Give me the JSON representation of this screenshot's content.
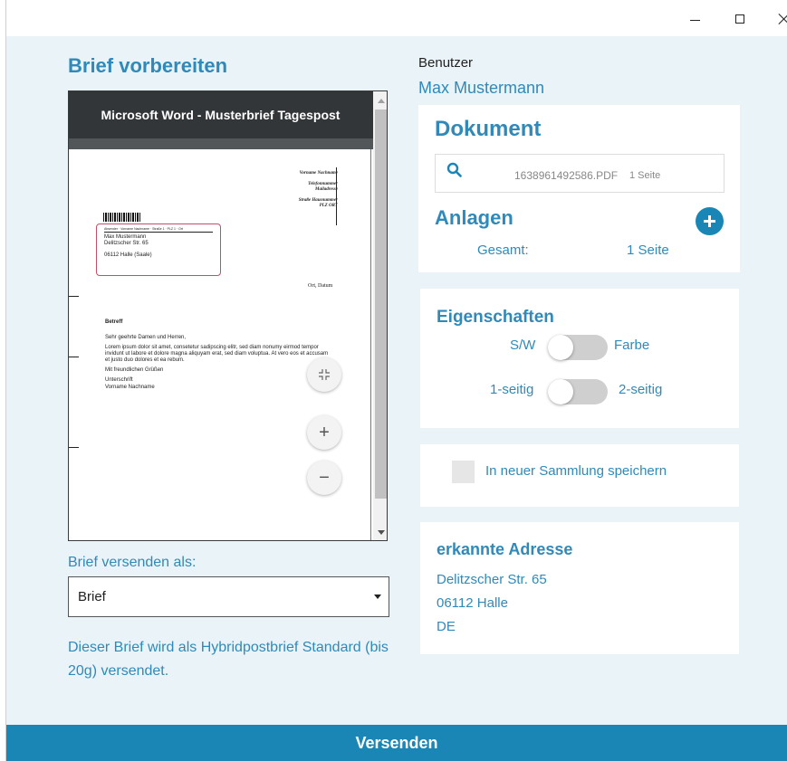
{
  "window": {
    "minimize_icon": "minimize-icon",
    "maximize_icon": "maximize-icon",
    "close_icon": "close-icon"
  },
  "main": {
    "title": "Brief vorbereiten",
    "preview": {
      "header_title": "Microsoft Word - Musterbrief Tagespost",
      "sender_lines": [
        "Vorname Nachname",
        "Telefonnummer",
        "Mailadresse",
        "Straße Hausnummer",
        "PLZ ORT"
      ],
      "address_sender_line": "Absender · Vorname Nachname · Straße 1 · PLZ 1 · Ort",
      "address_lines": [
        "Max Mustermann",
        "Delitzscher Str. 65",
        "06112 Halle (Saale)"
      ],
      "ort_datum": "Ort, Datum",
      "subject": "Betreff",
      "salutation": "Sehr geehrte Damen und Herren,",
      "body": "Lorem ipsum dolor sit amet, consetetur sadipscing elitr, sed diam nonumy eirmod tempor invidunt ut labore et dolore magna aliquyam erat, sed diam voluptua. At vero eos et accusam et justo duo dolores et ea rebum.",
      "closing": "Mit freundlichen Grüßen",
      "signature": "Unterschrift",
      "name": "Vorname Nachname",
      "zoom_in_label": "+",
      "zoom_out_label": "−",
      "fit_icon": "collapse-arrows-icon"
    },
    "send_as": {
      "label": "Brief versenden als:",
      "selected": "Brief"
    },
    "info_text": "Dieser Brief wird als Hybridpostbrief Standard (bis 20g) versendet."
  },
  "user": {
    "label": "Benutzer",
    "name": "Max Mustermann"
  },
  "document": {
    "title": "Dokument",
    "file_name": "1638961492586.PDF",
    "file_pages": "1 Seite",
    "attachments_title": "Anlagen",
    "total_label": "Gesamt:",
    "total_value": "1 Seite"
  },
  "properties": {
    "title": "Eigenschaften",
    "color_toggle": {
      "left": "S/W",
      "right": "Farbe"
    },
    "sides_toggle": {
      "left": "1-seitig",
      "right": "2-seitig"
    }
  },
  "collection": {
    "label": "In neuer Sammlung speichern"
  },
  "address": {
    "title": "erkannte Adresse",
    "lines": [
      "Delitzscher Str. 65",
      "06112 Halle",
      "DE"
    ]
  },
  "footer": {
    "send_label": "Versenden"
  },
  "colors": {
    "accent": "#2f8ab9",
    "send_bar": "#1a86b5",
    "background": "#eaf3f8",
    "preview_header": "#323639"
  }
}
